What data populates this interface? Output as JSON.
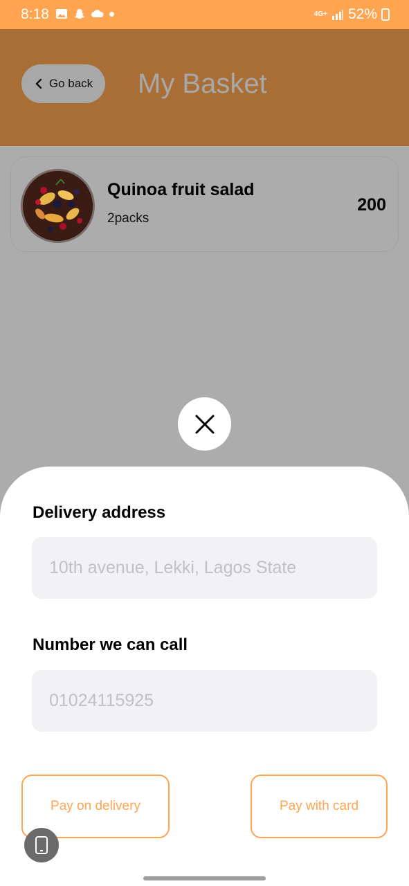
{
  "status_bar": {
    "time": "8:18",
    "network": "4G+",
    "battery": "52%",
    "icons_left": [
      "gallery-icon",
      "snapchat-icon",
      "cloud-icon",
      "dot-icon"
    ],
    "icons_right": [
      "network-icon",
      "signal-icon",
      "battery-icon"
    ]
  },
  "header": {
    "back_label": "Go back",
    "title": "My Basket"
  },
  "basket": {
    "items": [
      {
        "name": "Quinoa fruit salad",
        "quantity": "2packs",
        "price": "200"
      }
    ]
  },
  "checkout_sheet": {
    "address_label": "Delivery address",
    "address_placeholder": "10th avenue, Lekki, Lagos State",
    "phone_label": "Number we can call",
    "phone_placeholder": "01024115925",
    "pay_delivery_label": "Pay on delivery",
    "pay_card_label": "Pay with card"
  },
  "colors": {
    "accent": "#ffa451",
    "header_dimmed": "#a96d36",
    "overlay": "#acacac"
  }
}
